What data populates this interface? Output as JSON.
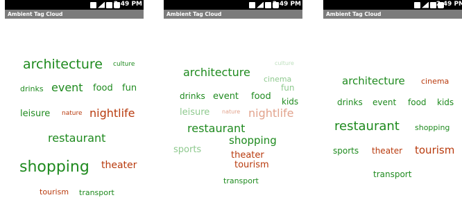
{
  "colors": {
    "green": "#1e8a1e",
    "red": "#b83a0d",
    "light_green": "#8ec98e",
    "light_red": "#e2a38d"
  },
  "icons": [
    "sync-icon",
    "signal-icon",
    "network-icon",
    "battery-icon"
  ],
  "screens": [
    {
      "status": {
        "time": "2:49 PM"
      },
      "title": "Ambient Tag Cloud",
      "tags": [
        "architecture",
        "culture",
        "drinks",
        "event",
        "food",
        "fun",
        "leisure",
        "nature",
        "nightlife",
        "restaurant",
        "shopping",
        "theater",
        "tourism",
        "transport"
      ]
    },
    {
      "status": {
        "time": "2:49 PM"
      },
      "title": "Ambient Tag Cloud",
      "tags": [
        "culture",
        "architecture",
        "cinema",
        "fun",
        "drinks",
        "event",
        "food",
        "kids",
        "leisure",
        "nature",
        "nightlife",
        "restaurant",
        "shopping",
        "sports",
        "theater",
        "tourism",
        "transport"
      ]
    },
    {
      "status": {
        "time": "2:49 PM"
      },
      "title": "Ambient Tag Cloud",
      "tags": [
        "architecture",
        "cinema",
        "drinks",
        "event",
        "food",
        "kids",
        "restaurant",
        "shopping",
        "sports",
        "theater",
        "tourism",
        "transport"
      ]
    }
  ]
}
